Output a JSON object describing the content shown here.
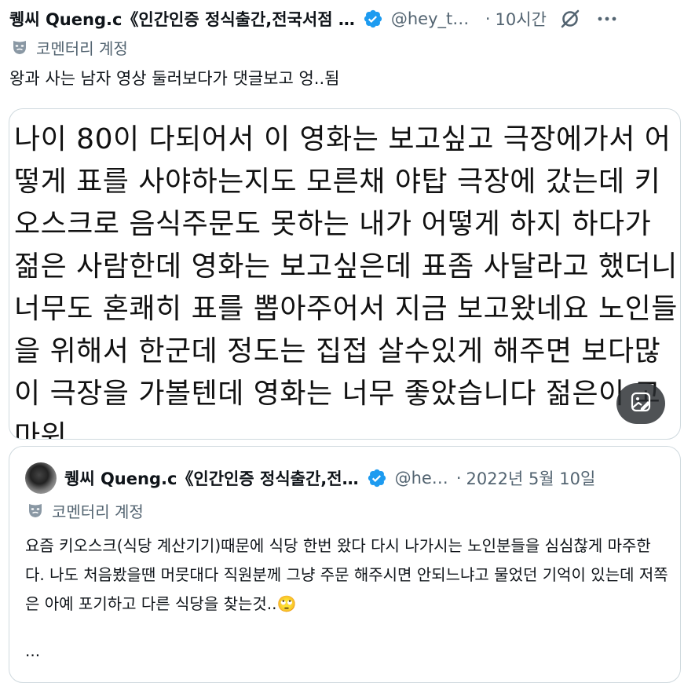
{
  "tweet": {
    "author_name": "퀭씨 Queng.c《인간인증 정식출간,전국서점 …",
    "handle": "@hey_ti…",
    "separator": "·",
    "time": "10시간",
    "label": "코멘터리 계정",
    "text": "왕과 사는 남자 영상 둘러보다가 댓글보고 엉..됨",
    "image_text": "나이 80이 다되어서 이 영화는 보고싶고 극장에가서 어떻게 표를 사야하는지도 모른채 야탑 극장에 갔는데 키오스크로 음식주문도 못하는 내가 어떻게 하지 하다가 젊은 사람한데 영화는 보고싶은데 표좀 사달라고 했더니 너무도 혼쾌히 표를 뽑아주어서 지금 보고왔네요 노인들을 위해서 한군데 정도는 집접 살수있게 해주면 보다많이 극장을 가볼텐데 영화는 너무 좋았습니다 젊은이 고마워"
  },
  "quoted": {
    "author_name": "퀭씨 Queng.c《인간인증 정식출간,전…",
    "handle": "@he…",
    "separator": "·",
    "date": "2022년 5월 10일",
    "label": "코멘터리 계정",
    "text": "요즘 키오스크(식당 계산기기)때문에 식당 한번 왔다 다시 나가시는 노인분들을 심심찮게 마주한다. 나도 처음봤을땐 머뭇대다 직원분께 그냥 주문 해주시면 안되느냐고 물었던 기억이 있는데 저쪽은 아예 포기하고 다른 식당을 찾는것..🙄",
    "more": "..."
  },
  "colors": {
    "verified": "#1d9bf0",
    "secondary_text": "#536471",
    "border": "#cfd9de"
  },
  "icons": {
    "verified": "verified-badge-icon",
    "grok": "grok-icon",
    "more": "more-icon",
    "mask": "theater-mask-icon",
    "alt": "image-edit-icon"
  }
}
